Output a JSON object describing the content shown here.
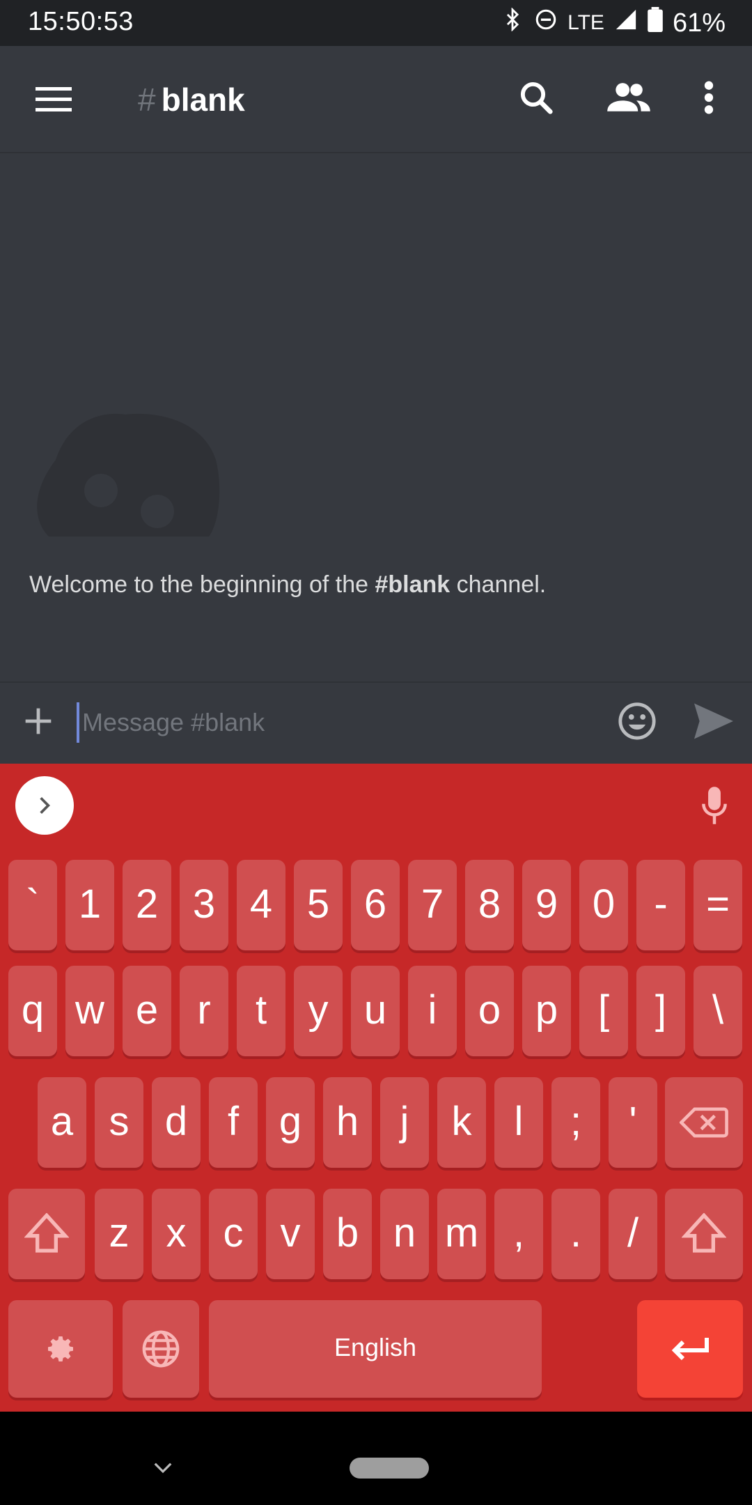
{
  "status": {
    "time": "15:50:53",
    "network": "LTE",
    "battery": "61%"
  },
  "appbar": {
    "channel": "blank",
    "hash": "#",
    "icons": [
      "menu-icon",
      "search-icon",
      "members-icon",
      "more-icon"
    ]
  },
  "chat": {
    "welcome_prefix": "Welcome to the beginning of the ",
    "welcome_channel": "#blank",
    "welcome_suffix": " channel."
  },
  "input": {
    "placeholder": "Message #blank",
    "value": ""
  },
  "keyboard": {
    "lang": "English",
    "row_numbers": [
      "`",
      "1",
      "2",
      "3",
      "4",
      "5",
      "6",
      "7",
      "8",
      "9",
      "0",
      "-",
      "="
    ],
    "row_q": [
      "q",
      "w",
      "e",
      "r",
      "t",
      "y",
      "u",
      "i",
      "o",
      "p",
      "[",
      "]",
      "\\"
    ],
    "row_a": [
      "a",
      "s",
      "d",
      "f",
      "g",
      "h",
      "j",
      "k",
      "l",
      ";",
      "'"
    ],
    "row_z": [
      "z",
      "x",
      "c",
      "v",
      "b",
      "n",
      "m",
      ",",
      ".",
      "/"
    ],
    "accent": "#c62828"
  }
}
